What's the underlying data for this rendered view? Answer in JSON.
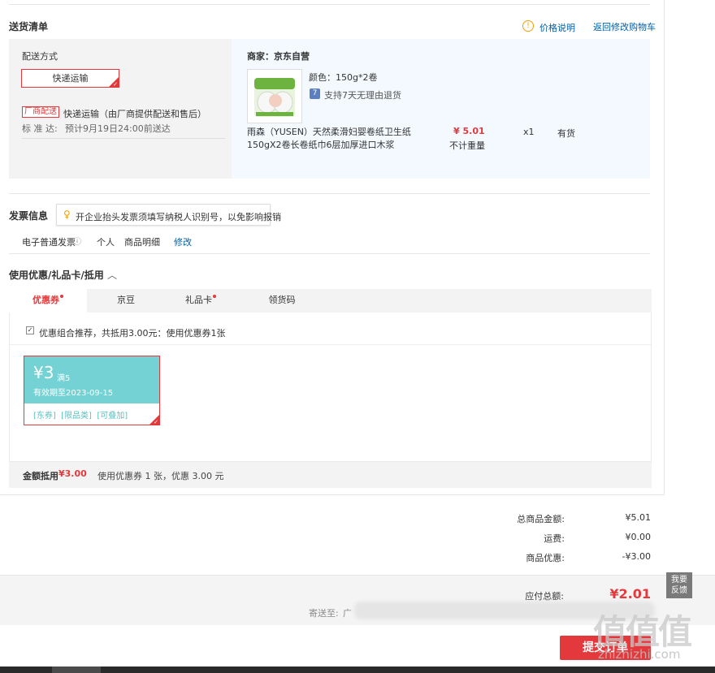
{
  "delivery": {
    "title": "送货清单",
    "price_note": "价格说明",
    "back_to_cart": "返回修改购物车",
    "method_label": "配送方式",
    "method_button": "快递运输",
    "tag": "厂商配送",
    "method_desc": "快递运输（由厂商提供配送和售后）",
    "standard_label": "标 准 达:",
    "standard_value": "预计9月19日24:00前送达",
    "merchant": "商家：京东自营",
    "color_label": "颜色：150g*2卷",
    "return_badge": "7",
    "return_text": "支持7天无理由退货",
    "product_name_1": "雨森（YUSEN）天然柔滑妇婴卷纸卫生纸",
    "product_name_2": "150gX2卷长卷纸巾6层加厚进口木浆",
    "price": "¥ 5.01",
    "weight": "不计重量",
    "quantity": "x1",
    "stock": "有货"
  },
  "invoice": {
    "title": "发票信息",
    "tip": "开企业抬头发票须填写纳税人识别号，以免影响报销",
    "type": "电子普通发票",
    "info_icon": "ⓘ",
    "person": "个人",
    "detail": "商品明细",
    "modify": "修改"
  },
  "coupons": {
    "title": "使用优惠/礼品卡/抵用",
    "tabs": [
      {
        "label": "优惠券",
        "dot": true
      },
      {
        "label": "京豆",
        "dot": false
      },
      {
        "label": "礼品卡",
        "dot": true
      },
      {
        "label": "领货码",
        "dot": false
      }
    ],
    "recommend": "优惠组合推荐，共抵用3.00元：使用优惠券1张",
    "coupon_amount": "¥3",
    "coupon_condition": "满5",
    "coupon_expire": "有效期至2023-09-15",
    "coupon_tags": "[东券]  [限品类]  [可叠加]",
    "summary_label": "金额抵用",
    "summary_amount": "¥3.00",
    "summary_desc": "使用优惠券 1 张，优惠 3.00 元"
  },
  "totals": {
    "goods_label": "总商品金额:",
    "goods_value": "¥5.01",
    "freight_label": "运费:",
    "freight_value": "¥0.00",
    "discount_label": "商品优惠:",
    "discount_value": "-¥3.00",
    "payable_label": "应付总额:",
    "payable_value": "¥2.01",
    "ship_to_label": "寄送至:",
    "ship_to_value": "广"
  },
  "submit": "提交订单",
  "feedback": {
    "line1": "我要",
    "line2": "反馈"
  },
  "watermark": {
    "text": "值值值",
    "url": "zhizhizhi.com"
  },
  "colors": {
    "accent": "#e4393c",
    "link": "#005ea7",
    "coupon": "#74d2d4"
  }
}
